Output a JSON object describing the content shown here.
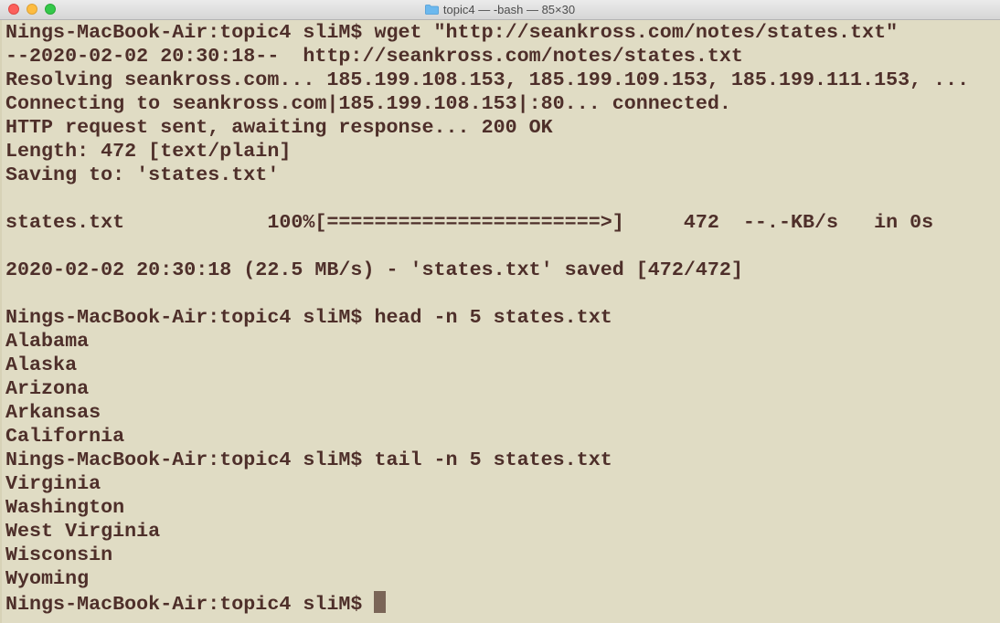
{
  "window": {
    "title": "topic4 — -bash — 85×30"
  },
  "terminal": {
    "lines": [
      "Nings-MacBook-Air:topic4 sliM$ wget \"http://seankross.com/notes/states.txt\"",
      "--2020-02-02 20:30:18--  http://seankross.com/notes/states.txt",
      "Resolving seankross.com... 185.199.108.153, 185.199.109.153, 185.199.111.153, ...",
      "Connecting to seankross.com|185.199.108.153|:80... connected.",
      "HTTP request sent, awaiting response... 200 OK",
      "Length: 472 [text/plain]",
      "Saving to: 'states.txt'",
      "",
      "states.txt            100%[=======================>]     472  --.-KB/s   in 0s",
      "",
      "2020-02-02 20:30:18 (22.5 MB/s) - 'states.txt' saved [472/472]",
      "",
      "Nings-MacBook-Air:topic4 sliM$ head -n 5 states.txt",
      "Alabama",
      "Alaska",
      "Arizona",
      "Arkansas",
      "California",
      "Nings-MacBook-Air:topic4 sliM$ tail -n 5 states.txt",
      "Virginia",
      "Washington",
      "West Virginia",
      "Wisconsin",
      "Wyoming"
    ],
    "prompt": "Nings-MacBook-Air:topic4 sliM$ "
  }
}
